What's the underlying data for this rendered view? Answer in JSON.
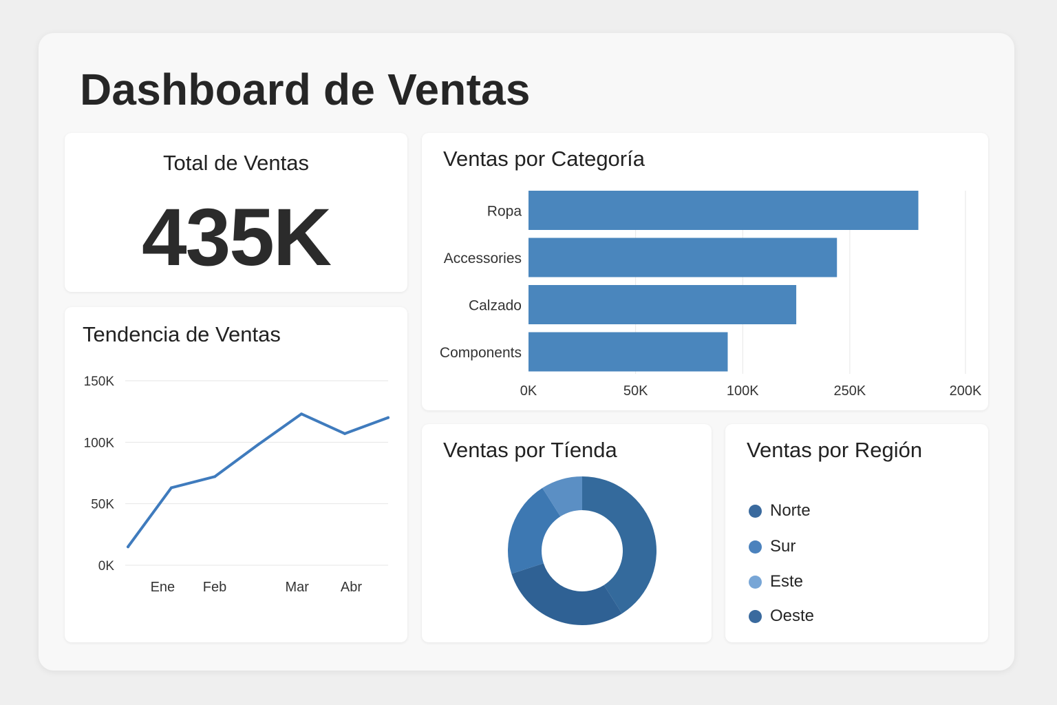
{
  "page": {
    "title": "Dashboard de Ventas"
  },
  "kpi": {
    "label": "Total de Ventas",
    "value": "435K"
  },
  "trend_card": {
    "title": "Tendencia de Ventas"
  },
  "category_card": {
    "title": "Ventas por Categoría"
  },
  "store_card": {
    "title": "Ventas por Tíenda"
  },
  "region_card": {
    "title": "Ventas por Región",
    "items": [
      {
        "label": "Norte",
        "color": "#3a6a9e"
      },
      {
        "label": "Sur",
        "color": "#4b82bd"
      },
      {
        "label": "Este",
        "color": "#78a6d6"
      },
      {
        "label": "Oeste",
        "color": "#3a6a9e"
      }
    ]
  },
  "colors": {
    "bar": "#4a86bd",
    "line": "#3f7bbd",
    "grid": "#e6e6e6"
  },
  "chart_data": [
    {
      "type": "line",
      "title": "Tendencia de Ventas",
      "y_ticks": [
        "0K",
        "50K",
        "100K",
        "150K"
      ],
      "ylim": [
        0,
        150
      ],
      "x_tick_labels": [
        {
          "label": "Ene",
          "x": 0.8
        },
        {
          "label": "Feb",
          "x": 2
        },
        {
          "label": "Mar",
          "x": 3.9
        },
        {
          "label": "Abr",
          "x": 5.15
        }
      ],
      "xlim": [
        0,
        6
      ],
      "series": [
        {
          "x": [
            0,
            1,
            2,
            3,
            4,
            5,
            6
          ],
          "y": [
            15,
            63,
            72,
            98,
            123,
            107,
            120
          ]
        }
      ],
      "grid": true
    },
    {
      "type": "bar",
      "orientation": "horizontal",
      "title": "Ventas por Categoría",
      "categories": [
        "Ropa",
        "Accessories",
        "Calzado",
        "Components"
      ],
      "values": [
        182,
        144,
        125,
        93
      ],
      "x_ticks": [
        {
          "label": "0K",
          "v": 0
        },
        {
          "label": "50K",
          "v": 50
        },
        {
          "label": "100K",
          "v": 100
        },
        {
          "label": "250K",
          "v": 150
        },
        {
          "label": "200K",
          "v": 204
        }
      ],
      "xlim": [
        0,
        204
      ],
      "grid": true
    },
    {
      "type": "pie",
      "donut": true,
      "title": "Ventas por Tíenda",
      "slices": [
        {
          "value": 41,
          "color": "#346a9c"
        },
        {
          "value": 29,
          "color": "#2f6194"
        },
        {
          "value": 21,
          "color": "#3d78b2"
        },
        {
          "value": 9,
          "color": "#5b8fc4"
        }
      ]
    }
  ]
}
